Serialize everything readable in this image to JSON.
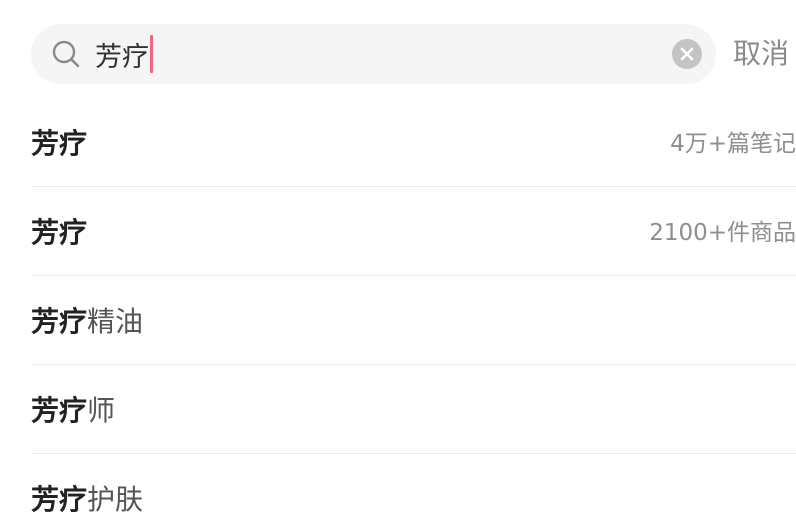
{
  "search": {
    "query": "芳疗",
    "cancel_label": "取消"
  },
  "suggestions": [
    {
      "keyword": "芳疗",
      "suffix": "",
      "meta": "4万+篇笔记"
    },
    {
      "keyword": "芳疗",
      "suffix": "",
      "meta": "2100+件商品"
    },
    {
      "keyword": "芳疗",
      "suffix": "精油",
      "meta": ""
    },
    {
      "keyword": "芳疗",
      "suffix": "师",
      "meta": ""
    },
    {
      "keyword": "芳疗",
      "suffix": "护肤",
      "meta": ""
    }
  ],
  "colors": {
    "caret": "#f0667e",
    "search_bg": "#f5f5f5",
    "clear_bg": "#c4c4c4",
    "muted_text": "#8e8e8e"
  },
  "icons": {
    "search": "search-icon",
    "clear": "close-icon"
  }
}
